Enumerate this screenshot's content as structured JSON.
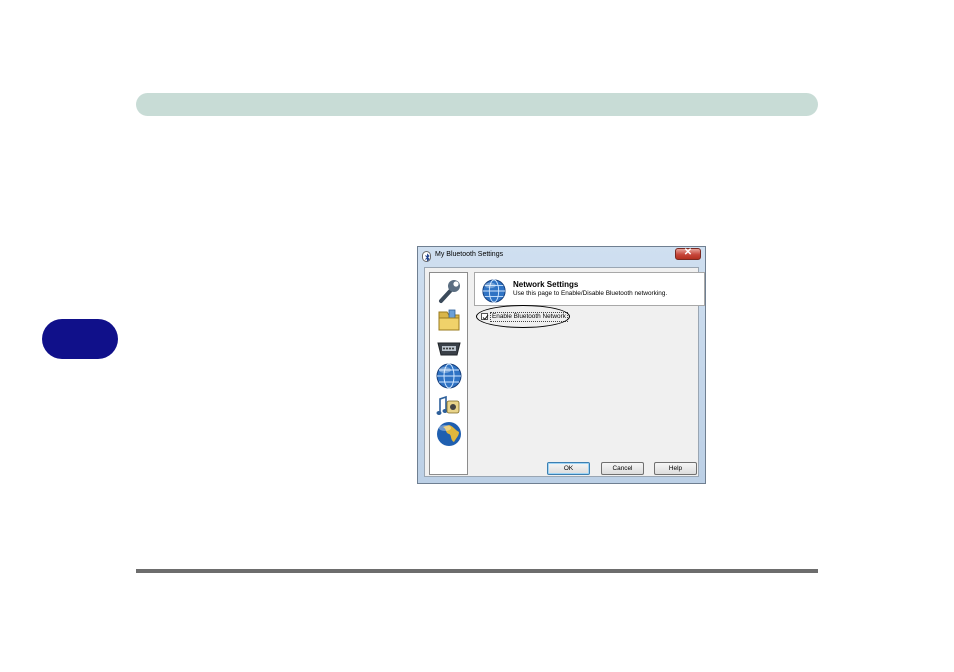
{
  "dialog": {
    "title": "My Bluetooth Settings",
    "close_glyph": "✕"
  },
  "sidebar": {
    "icons": [
      "wrench-icon",
      "folder-icon",
      "serial-port-icon",
      "network-globe-icon",
      "audio-music-icon",
      "globe-icon"
    ]
  },
  "header": {
    "title": "Network Settings",
    "subtitle": "Use this page to Enable/Disable Bluetooth networking."
  },
  "option": {
    "label": "Enable Bluetooth Network",
    "checked": true
  },
  "buttons": {
    "ok": "OK",
    "cancel": "Cancel",
    "help": "Help"
  },
  "colors": {
    "top_bar": "#c8dcd6",
    "chapter_tab": "#10108a",
    "close_button": "#c7463a"
  }
}
